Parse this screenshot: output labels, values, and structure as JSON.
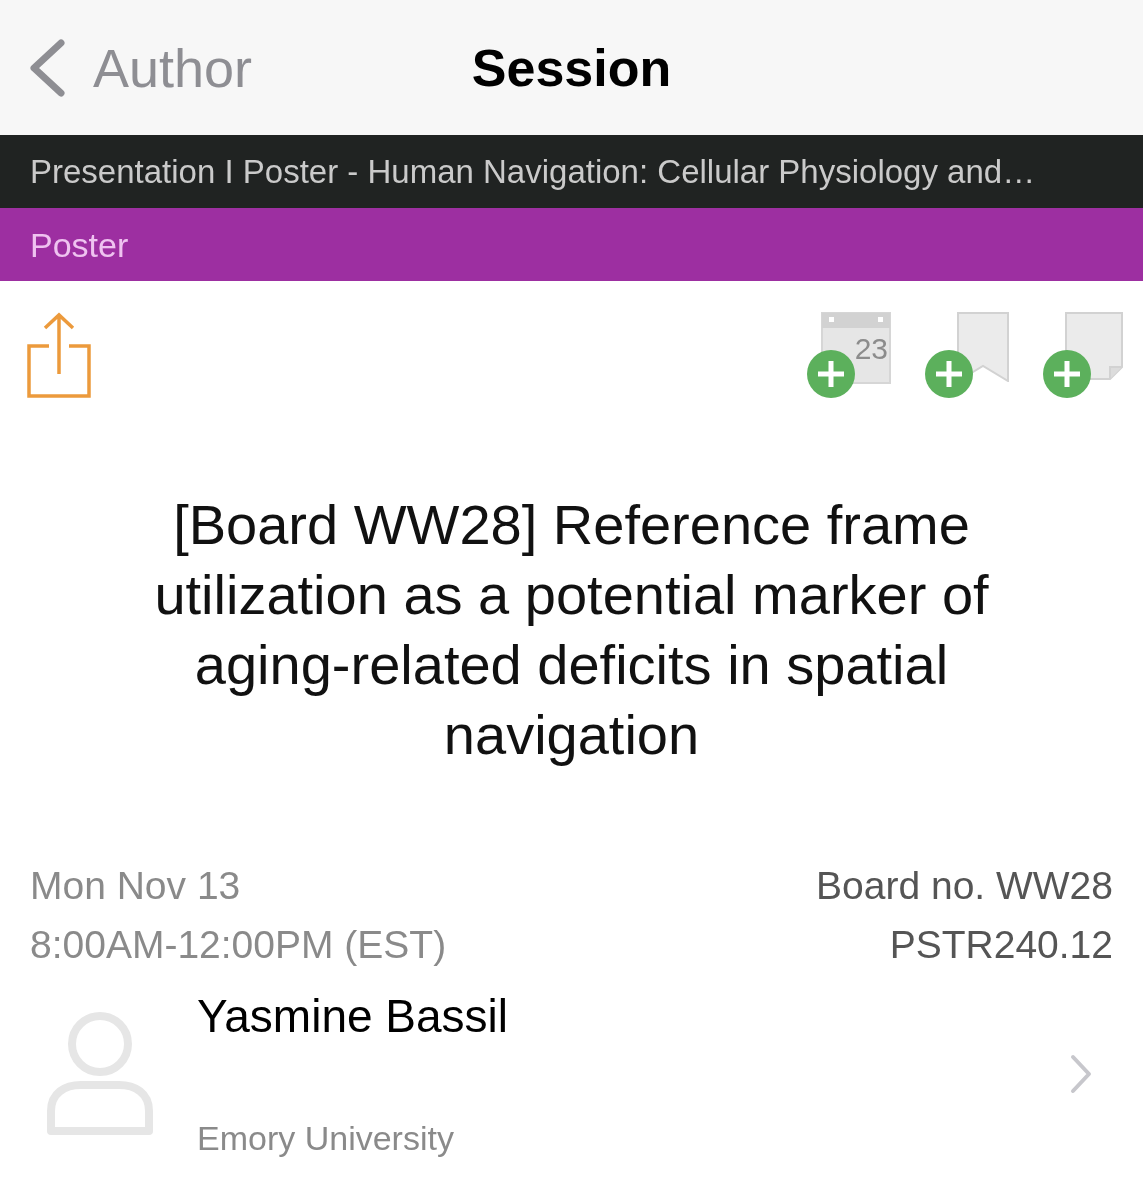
{
  "nav_bar": {
    "back_label": "Author",
    "title": "Session"
  },
  "breadcrumb_bar": {
    "text": "Presentation I Poster - Human Navigation: Cellular Physiology and…"
  },
  "type_bar": {
    "label": "Poster"
  },
  "toolbar": {
    "actions": [
      {
        "kind": "calendar",
        "day": "23"
      },
      {
        "kind": "bookmark"
      },
      {
        "kind": "note"
      }
    ]
  },
  "title": "[Board WW28] Reference frame utilization as a potential marker of aging-related deficits in spatial navigation",
  "details": {
    "date": "Mon Nov 13",
    "time": "8:00AM-12:00PM (EST)",
    "board": "Board no. WW28",
    "code": "PSTR240.12"
  },
  "authors": [
    {
      "name": "Yasmine Bassil",
      "affiliation": "Emory University"
    }
  ]
}
